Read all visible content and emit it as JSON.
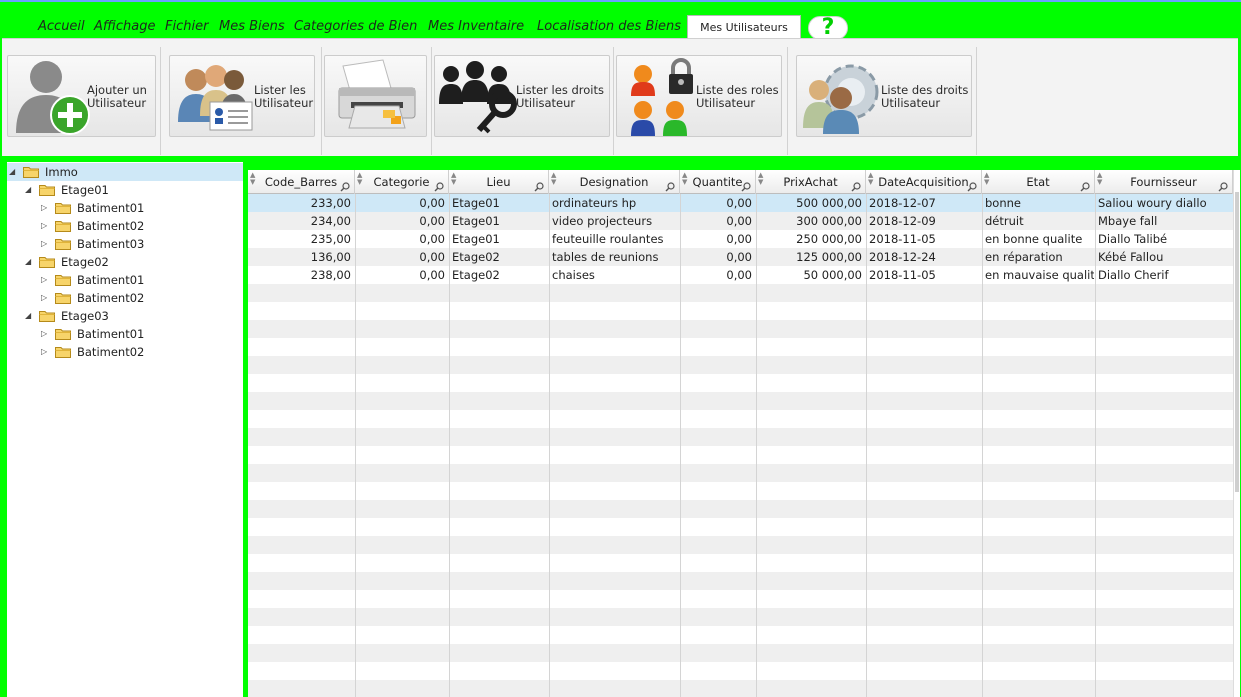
{
  "menu": {
    "items": [
      "Accueil",
      "Affichage",
      "Fichier",
      "Mes Biens",
      "Categories de Bien",
      "Mes Inventaire",
      "Localisation des Biens"
    ],
    "active_tab": "Mes Utilisateurs"
  },
  "ribbon": {
    "buttons": [
      {
        "line1": "Ajouter un",
        "line2": "Utilisateur",
        "icon": "add-user-icon"
      },
      {
        "line1": "Lister les",
        "line2": "Utilisateur",
        "icon": "user-list-icon"
      },
      {
        "line1": "",
        "line2": "",
        "icon": "printer-icon"
      },
      {
        "line1": "Lister les droits",
        "line2": "Utilisateur",
        "icon": "users-key-icon"
      },
      {
        "line1": "Liste des roles",
        "line2": "Utilisateur",
        "icon": "roles-lock-icon"
      },
      {
        "line1": "Liste des droits",
        "line2": "Utilisateur",
        "icon": "users-gear-icon"
      }
    ]
  },
  "tree": {
    "root": "Immo",
    "floors": [
      {
        "name": "Etage01",
        "buildings": [
          "Batiment01",
          "Batiment02",
          "Batiment03"
        ]
      },
      {
        "name": "Etage02",
        "buildings": [
          "Batiment01",
          "Batiment02"
        ]
      },
      {
        "name": "Etage03",
        "buildings": [
          "Batiment01",
          "Batiment02"
        ]
      }
    ]
  },
  "grid": {
    "columns": [
      "Code_Barres",
      "Categorie",
      "Lieu",
      "Designation",
      "Quantite",
      "PrixAchat",
      "DateAcquisition",
      "Etat",
      "Fournisseur"
    ],
    "rows": [
      [
        "233,00",
        "0,00",
        "Etage01",
        "ordinateurs hp",
        "0,00",
        "500 000,00",
        "2018-12-07",
        "bonne",
        "Saliou woury diallo"
      ],
      [
        "234,00",
        "0,00",
        "Etage01",
        "video projecteurs",
        "0,00",
        "300 000,00",
        "2018-12-09",
        "détruit",
        "Mbaye fall"
      ],
      [
        "235,00",
        "0,00",
        "Etage01",
        "feuteuille roulantes",
        "0,00",
        "250 000,00",
        "2018-11-05",
        "en bonne qualite",
        "Diallo Talibé"
      ],
      [
        "136,00",
        "0,00",
        "Etage02",
        "tables de reunions",
        "0,00",
        "125 000,00",
        "2018-12-24",
        "en réparation",
        "Kébé Fallou"
      ],
      [
        "238,00",
        "0,00",
        "Etage02",
        "chaises",
        "0,00",
        "50 000,00",
        "2018-11-05",
        "en mauvaise qualite",
        "Diallo Cherif"
      ]
    ],
    "selected_row": 0
  },
  "colors": {
    "background": "#00ff00",
    "selection": "#cfe8f7",
    "help_icon": "#00d000"
  }
}
